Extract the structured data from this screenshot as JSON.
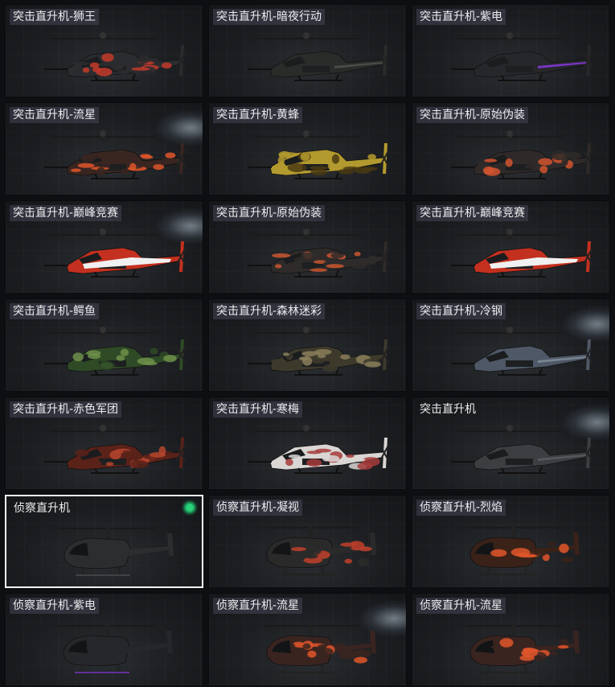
{
  "tiles": [
    {
      "label": "突击直升机-狮王",
      "type": "attack",
      "camo": "lion",
      "primary": "#2b2c2f",
      "accent": "#c33a2a",
      "light": false,
      "selected": false
    },
    {
      "label": "突击直升机-暗夜行动",
      "type": "attack",
      "camo": "solid",
      "primary": "#2a2c2a",
      "accent": "#4a4d49",
      "light": false,
      "selected": false
    },
    {
      "label": "突击直升机-紫电",
      "type": "attack",
      "camo": "solid",
      "primary": "#26272b",
      "accent": "#7a35c6",
      "light": false,
      "selected": false
    },
    {
      "label": "突击直升机-流星",
      "type": "attack",
      "camo": "splotch",
      "primary": "#3a2621",
      "accent": "#e0562a",
      "light": true,
      "selected": false
    },
    {
      "label": "突击直升机-黄蜂",
      "type": "attack",
      "camo": "splotch",
      "primary": "#b39a2e",
      "accent": "#4a3a12",
      "light": false,
      "selected": false
    },
    {
      "label": "突击直升机-原始伪装",
      "type": "attack",
      "camo": "splotch",
      "primary": "#2f2a29",
      "accent": "#d0542e",
      "light": false,
      "selected": false
    },
    {
      "label": "突击直升机-巅峰竞赛",
      "type": "attack",
      "camo": "stripe",
      "primary": "#c4301f",
      "accent": "#f0f0f0",
      "light": true,
      "selected": false
    },
    {
      "label": "突击直升机-原始伪装",
      "type": "attack",
      "camo": "splotch",
      "primary": "#2f2b2a",
      "accent": "#c9562f",
      "light": false,
      "selected": false
    },
    {
      "label": "突击直升机-巅峰竞赛",
      "type": "attack",
      "camo": "stripe",
      "primary": "#c4301f",
      "accent": "#f0f0f0",
      "light": false,
      "selected": false
    },
    {
      "label": "突击直升机-鳄鱼",
      "type": "attack",
      "camo": "splotch",
      "primary": "#2f4a26",
      "accent": "#6d8f4a",
      "light": false,
      "selected": false
    },
    {
      "label": "突击直升机-森林迷彩",
      "type": "attack",
      "camo": "splotch",
      "primary": "#3d3a2c",
      "accent": "#8a7f5a",
      "light": false,
      "selected": false
    },
    {
      "label": "突击直升机-冷钢",
      "type": "attack",
      "camo": "solid",
      "primary": "#4e5866",
      "accent": "#7a8592",
      "light": true,
      "selected": false
    },
    {
      "label": "突击直升机-赤色军团",
      "type": "attack",
      "camo": "splotch",
      "primary": "#5a2219",
      "accent": "#b6452e",
      "light": false,
      "selected": false
    },
    {
      "label": "突击直升机-寒梅",
      "type": "attack",
      "camo": "splotch",
      "primary": "#d9d6d3",
      "accent": "#a63b3b",
      "light": false,
      "selected": false
    },
    {
      "label": "突击直升机",
      "type": "attack",
      "camo": "solid",
      "primary": "#3c3e41",
      "accent": "#55585c",
      "light": true,
      "selected": false,
      "plain": true
    },
    {
      "label": "侦察直升机",
      "type": "scout",
      "camo": "solid",
      "primary": "#2c2d2f",
      "accent": "#4a4c4f",
      "light": false,
      "selected": true,
      "plain": true
    },
    {
      "label": "侦察直升机-凝视",
      "type": "scout",
      "camo": "splotch",
      "primary": "#2a2a2a",
      "accent": "#c0402a",
      "light": false,
      "selected": false
    },
    {
      "label": "侦察直升机-烈焰",
      "type": "scout",
      "camo": "splotch",
      "primary": "#3a2218",
      "accent": "#e0562a",
      "light": false,
      "selected": false
    },
    {
      "label": "侦察直升机-紫电",
      "type": "scout",
      "camo": "solid",
      "primary": "#26272b",
      "accent": "#7a35c6",
      "light": false,
      "selected": false
    },
    {
      "label": "侦察直升机-流星",
      "type": "scout",
      "camo": "splotch",
      "primary": "#3a2420",
      "accent": "#e0562a",
      "light": true,
      "selected": false
    },
    {
      "label": "侦察直升机-流星",
      "type": "scout",
      "camo": "splotch",
      "primary": "#3a2420",
      "accent": "#e0562a",
      "light": false,
      "selected": false
    }
  ],
  "colors": {
    "selected_border": "#f2f2f2",
    "equipped_dot": "#2ad07a"
  }
}
